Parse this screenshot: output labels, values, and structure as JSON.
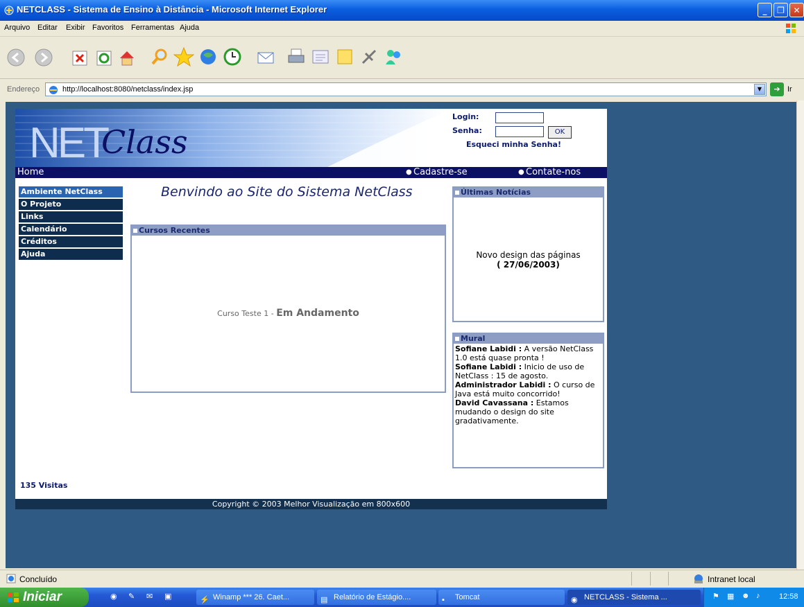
{
  "window": {
    "title": "NETCLASS - Sistema de Ensino à Distância - Microsoft Internet Explorer"
  },
  "menu": [
    "Arquivo",
    "Editar",
    "Exibir",
    "Favoritos",
    "Ferramentas",
    "Ajuda"
  ],
  "address": {
    "label": "Endereço",
    "url": "http://localhost:8080/netclass/index.jsp",
    "go_label": "Ir"
  },
  "site": {
    "logo": "NETClass",
    "login": {
      "login_label": "Login:",
      "senha_label": "Senha:",
      "ok_label": "OK",
      "forgot_label": "Esqueci minha Senha!"
    },
    "nav": {
      "home": "Home",
      "register": "Cadastre-se",
      "contact": "Contate-nos"
    },
    "sidebar": [
      {
        "label": "Ambiente NetClass"
      },
      {
        "label": "O Projeto"
      },
      {
        "label": "Links"
      },
      {
        "label": "Calendário"
      },
      {
        "label": "Créditos"
      },
      {
        "label": "Ajuda"
      }
    ],
    "welcome": "Benvindo ao Site do Sistema NetClass",
    "courses": {
      "heading": "Cursos Recentes",
      "course_name": "Curso Teste 1",
      "separator": " - ",
      "course_status": "Em Andamento"
    },
    "news": {
      "heading": "Últimas Notícias",
      "item_text": "Novo design das páginas",
      "item_date": "( 27/06/2003)"
    },
    "mural": {
      "heading": "Mural",
      "posts": [
        {
          "author": "Sofiane Labidi :",
          "text": " A versão NetClass 1.0 está quase pronta !"
        },
        {
          "author": "Sofiane Labidi :",
          "text": " Inicio de uso de NetClass : 15 de agosto."
        },
        {
          "author": "Administrador Labidi :",
          "text": " O curso de Java está muito concorrido!"
        },
        {
          "author": "David Cavassana :",
          "text": " Estamos mudando o design do site gradativamente."
        }
      ]
    },
    "visits": "135 Visitas",
    "copyright": "Copyright © 2003 Melhor Visualização em 800x600"
  },
  "status": {
    "text": "Concluído",
    "zone": "Intranet local"
  },
  "taskbar": {
    "start": "Iniciar",
    "tasks": [
      {
        "label": "Winamp *** 26. Caet..."
      },
      {
        "label": "Relatório de Estágio...."
      },
      {
        "label": "Tomcat"
      },
      {
        "label": "NETCLASS - Sistema ..."
      }
    ],
    "clock": "12:58"
  },
  "colors": {
    "nav_bar": "#0c1065",
    "sidebar_item": "#0e2c4e",
    "panel_header": "#8d9dc3",
    "page_background": "#2f5a83"
  }
}
